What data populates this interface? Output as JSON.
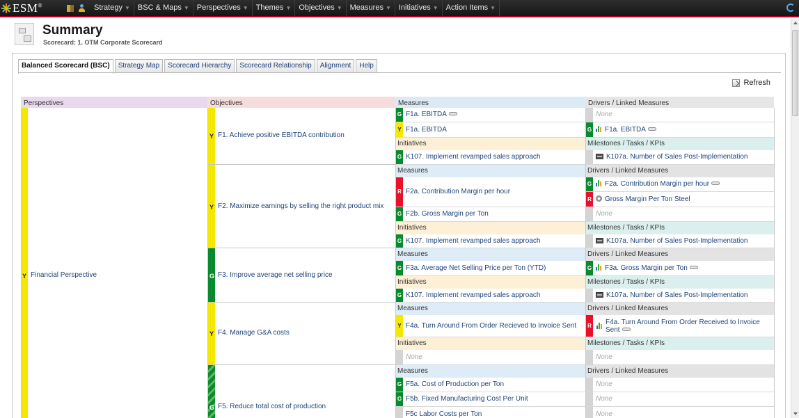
{
  "app": {
    "logo": "ESM",
    "logo_mark": "®"
  },
  "menu": [
    {
      "label": "Strategy"
    },
    {
      "label": "BSC & Maps"
    },
    {
      "label": "Perspectives"
    },
    {
      "label": "Themes"
    },
    {
      "label": "Objectives"
    },
    {
      "label": "Measures"
    },
    {
      "label": "Initiatives"
    },
    {
      "label": "Action Items"
    }
  ],
  "header": {
    "title": "Summary",
    "subtitle": "Scorecard: 1. OTM Corporate Scorecard"
  },
  "tabs": [
    {
      "label": "Balanced Scorecard (BSC)",
      "active": true
    },
    {
      "label": "Strategy Map"
    },
    {
      "label": "Scorecard Hierarchy"
    },
    {
      "label": "Scorecard Relationship"
    },
    {
      "label": "Alignment"
    },
    {
      "label": "Help"
    }
  ],
  "refresh_label": "Refresh",
  "columns": {
    "perspectives": "Perspectives",
    "objectives": "Objectives",
    "measures": "Measures",
    "drivers": "Drivers / Linked Measures"
  },
  "sub_labels": {
    "measures": "Measures",
    "drivers": "Drivers / Linked Measures",
    "initiatives": "Initiatives",
    "milestones": "Milestones / Tasks / KPIs",
    "none": "None"
  },
  "perspective": {
    "status": "Y",
    "name": "Financial Perspective"
  },
  "objectives": [
    {
      "status": "Y",
      "name": "F1. Achieve positive EBITDA contribution",
      "measures": [
        {
          "status": "G",
          "name": "F1a. EBITDA"
        },
        {
          "status": "Y",
          "name": "F1a. EBITDA"
        }
      ],
      "drivers": [
        {
          "status": "",
          "name": "None"
        },
        {
          "status": "G",
          "name": "F1a. EBITDA"
        }
      ],
      "initiatives": [
        {
          "status": "G",
          "name": "K107. Implement revamped sales approach"
        }
      ],
      "milestones": [
        {
          "name": "K107a. Number of Sales Post-Implementation"
        }
      ]
    },
    {
      "status": "Y",
      "name": "F2. Maximize earnings by selling the right product mix",
      "measures": [
        {
          "status": "R",
          "name": "F2a. Contribution Margin per hour"
        },
        {
          "status": "G",
          "name": "F2b. Gross Margin per Ton"
        }
      ],
      "drivers": [
        {
          "status": "G",
          "name": "F2a. Contribution Margin per hour"
        },
        {
          "status": "R",
          "name": "Gross Margin Per Ton Steel"
        },
        {
          "status": "",
          "name": "None"
        }
      ],
      "initiatives": [
        {
          "status": "G",
          "name": "K107. Implement revamped sales approach"
        }
      ],
      "milestones": [
        {
          "name": "K107a. Number of Sales Post-Implementation"
        }
      ]
    },
    {
      "status": "G",
      "name": "F3. Improve average net selling price",
      "measures": [
        {
          "status": "G",
          "name": "F3a. Average Net Selling Price per Ton (YTD)"
        }
      ],
      "drivers": [
        {
          "status": "G",
          "name": "F3a. Gross Margin per Ton"
        }
      ],
      "initiatives": [
        {
          "status": "G",
          "name": "K107. Implement revamped sales approach"
        }
      ],
      "milestones": [
        {
          "name": "K107a. Number of Sales Post-Implementation"
        }
      ]
    },
    {
      "status": "Y",
      "name": "F4. Manage G&A costs",
      "measures": [
        {
          "status": "Y",
          "name": "F4a. Turn Around From Order Recieved to Invoice Sent"
        }
      ],
      "drivers": [
        {
          "status": "R",
          "name": "F4a. Turn Around From Order Received to Invoice Sent"
        }
      ],
      "initiatives": [
        {
          "status": "",
          "name": "None"
        }
      ],
      "milestones": [
        {
          "name": "None"
        }
      ]
    },
    {
      "status": "G",
      "name": "F5. Reduce total cost of production",
      "measures": [
        {
          "status": "G",
          "name": "F5a. Cost of Production per Ton"
        },
        {
          "status": "G",
          "name": "F5b. Fixed Manufacturing Cost Per Unit"
        },
        {
          "status": "",
          "name": "F5c Labor Costs per Ton"
        }
      ],
      "drivers": [
        {
          "status": "",
          "name": "None"
        },
        {
          "status": "",
          "name": "None"
        },
        {
          "status": "",
          "name": "None"
        }
      ]
    }
  ]
}
